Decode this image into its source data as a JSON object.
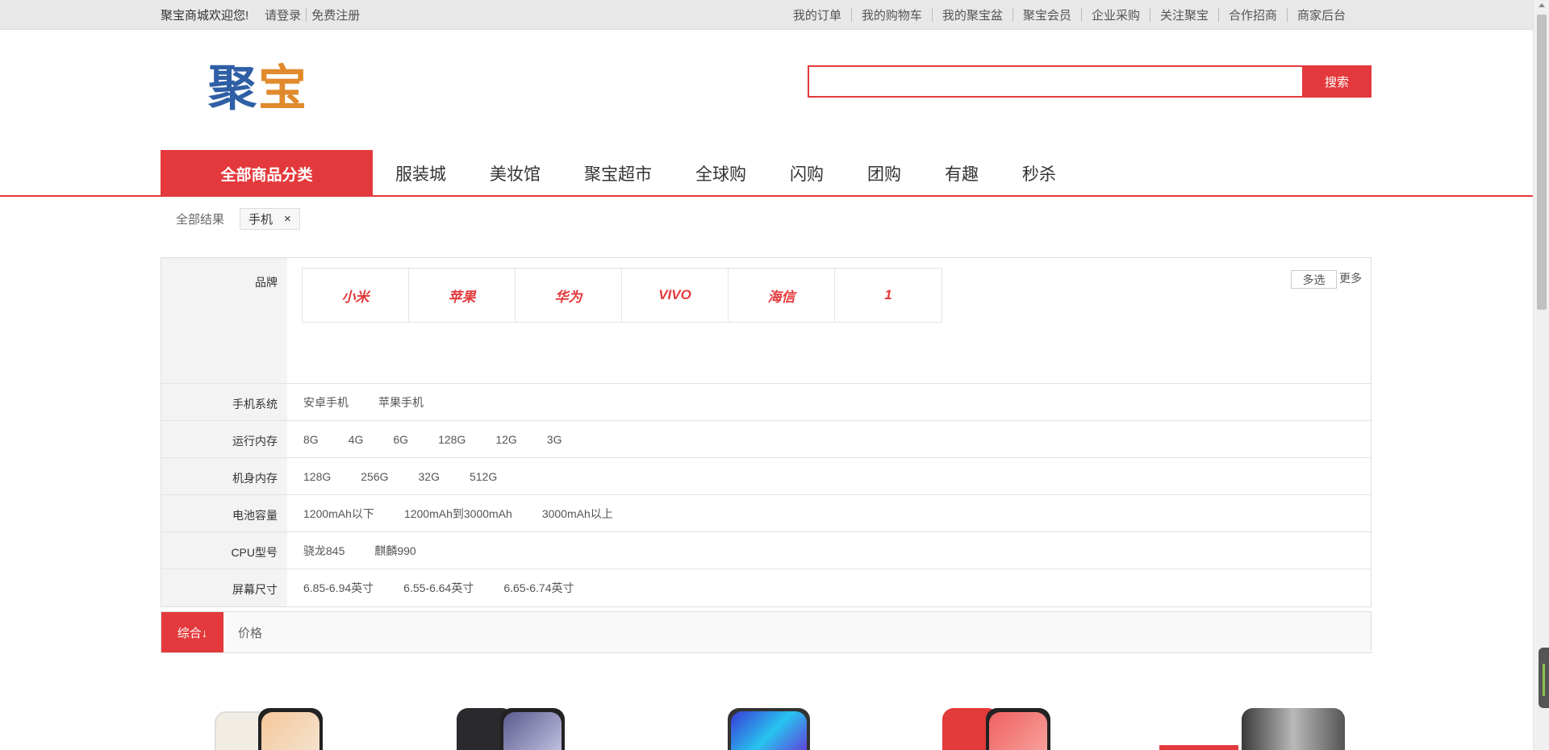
{
  "topbar": {
    "welcome": "聚宝商城欢迎您!",
    "login": "请登录",
    "register": "免费注册",
    "links": [
      "我的订单",
      "我的购物车",
      "我的聚宝盆",
      "聚宝会员",
      "企业采购",
      "关注聚宝",
      "合作招商",
      "商家后台"
    ]
  },
  "header": {
    "logo_text": "聚宝",
    "search_placeholder": "",
    "search_button": "搜索"
  },
  "nav": {
    "all_categories": "全部商品分类",
    "items": [
      "服装城",
      "美妆馆",
      "聚宝超市",
      "全球购",
      "闪购",
      "团购",
      "有趣",
      "秒杀"
    ]
  },
  "breadcrumb": {
    "all_results": "全部结果",
    "tag": "手机",
    "tag_close": "×"
  },
  "filters": {
    "brand": {
      "label": "品牌",
      "values": [
        "小米",
        "苹果",
        "华为",
        "VIVO",
        "海信",
        "1"
      ],
      "multi_select": "多选",
      "more": "更多"
    },
    "rows": [
      {
        "label": "手机系统",
        "values": [
          "安卓手机",
          "苹果手机"
        ]
      },
      {
        "label": "运行内存",
        "values": [
          "8G",
          "4G",
          "6G",
          "128G",
          "12G",
          "3G"
        ]
      },
      {
        "label": "机身内存",
        "values": [
          "128G",
          "256G",
          "32G",
          "512G"
        ]
      },
      {
        "label": "电池容量",
        "values": [
          "1200mAh以下",
          "1200mAh到3000mAh",
          "3000mAh以上"
        ]
      },
      {
        "label": "CPU型号",
        "values": [
          "骁龙845",
          "麒麟990"
        ]
      },
      {
        "label": "屏幕尺寸",
        "values": [
          "6.85-6.94英寸",
          "6.55-6.64英寸",
          "6.65-6.74英寸"
        ]
      }
    ]
  },
  "sort": {
    "composite": "综合↓",
    "price": "价格"
  },
  "colors": {
    "accent": "#e4393c",
    "logo_blue": "#2f5fa5",
    "logo_orange": "#e08a2c"
  }
}
